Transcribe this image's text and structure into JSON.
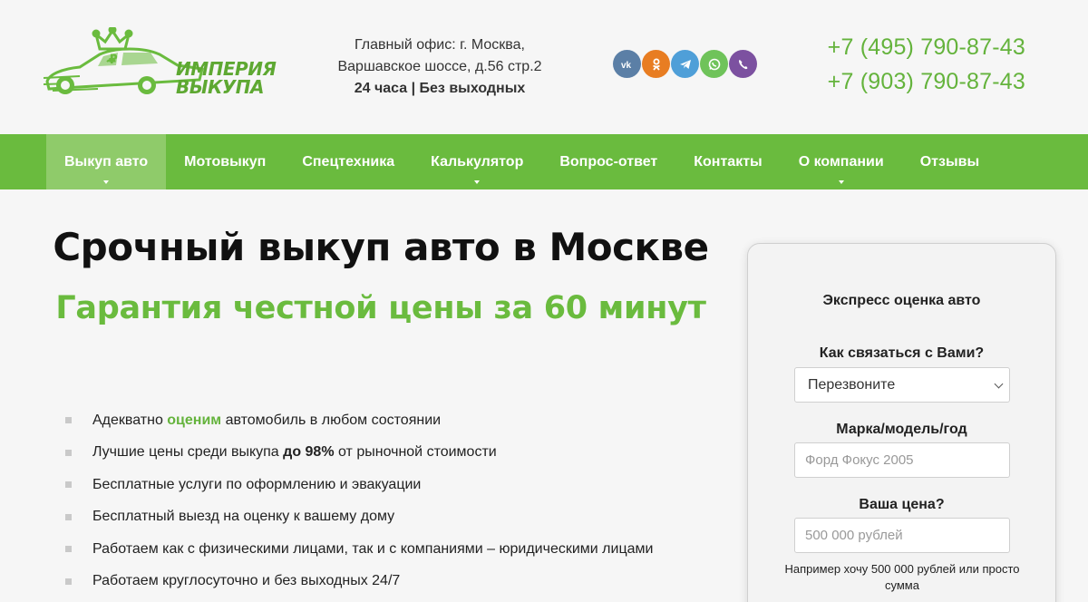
{
  "header": {
    "logo_text_line1": "ИМПЕРИЯ",
    "logo_text_line2": "ВЫКУПА",
    "office_line1": "Главный офис: г. Москва,",
    "office_line2": "Варшавское шоссе, д.56 стр.2",
    "hours": "24 часа | Без выходных",
    "phone1": "+7 (495) 790-87-43",
    "phone2": "+7 (903) 790-87-43",
    "socials": [
      {
        "name": "vk-icon",
        "color": "#5b7fa6"
      },
      {
        "name": "odnoklassniki-icon",
        "color": "#e87d22"
      },
      {
        "name": "telegram-icon",
        "color": "#4f9fd8"
      },
      {
        "name": "whatsapp-icon",
        "color": "#6fc35a"
      },
      {
        "name": "viber-icon",
        "color": "#7c51a0"
      }
    ]
  },
  "nav": {
    "items": [
      {
        "label": "Выкуп авто"
      },
      {
        "label": "Мотовыкуп"
      },
      {
        "label": "Спецтехника"
      },
      {
        "label": "Калькулятор"
      },
      {
        "label": "Вопрос-ответ"
      },
      {
        "label": "Контакты"
      },
      {
        "label": "О компании"
      },
      {
        "label": "Отзывы"
      }
    ]
  },
  "hero": {
    "title": "Срочный выкуп авто в Москве",
    "subtitle": "Гарантия честной цены за 60 минут"
  },
  "features": {
    "f1_before": "Адекватно ",
    "f1_green": "оценим",
    "f1_after": " автомобиль в любом состоянии",
    "f2_before": "Лучшие цены среди выкупа ",
    "f2_bold": "до 98%",
    "f2_after": " от рыночной стоимости",
    "f3": "Бесплатные услуги по оформлению и эвакуации",
    "f4": "Бесплатный выезд на оценку к вашему дому",
    "f5": "Работаем как с физическими лицами, так и с компаниями – юридическими лицами",
    "f6": "Работаем круглосуточно и без выходных 24/7"
  },
  "form": {
    "title": "Экспресс оценка авто",
    "contact_label": "Как связаться с Вами?",
    "contact_value": "Перезвоните",
    "model_label": "Марка/модель/год",
    "model_placeholder": "Форд Фокус 2005",
    "price_label": "Ваша цена?",
    "price_placeholder": "500 000 рублей",
    "hint": "Например хочу 500 000 рублей или просто сумма"
  },
  "colors": {
    "brand_green": "#6abb3e",
    "nav_active": "#8fcb6a",
    "phone_green": "#64b33c"
  }
}
